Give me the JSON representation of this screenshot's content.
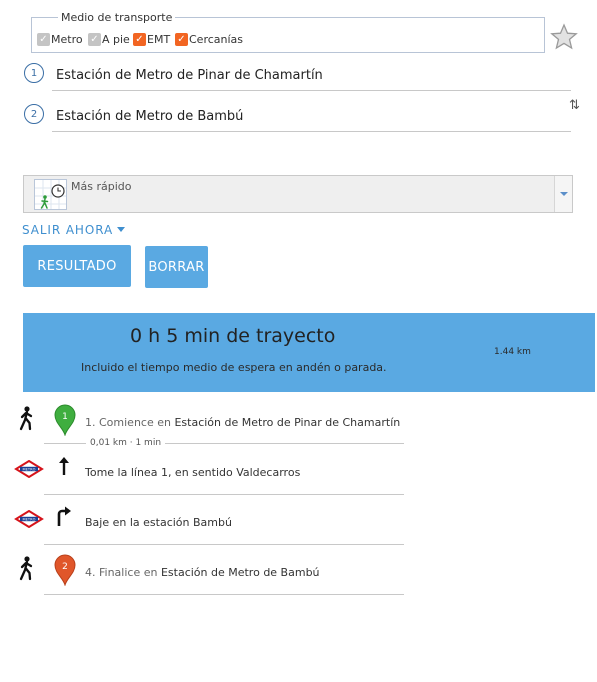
{
  "transport": {
    "legend": "Medio de transporte",
    "options": [
      {
        "label": "Metro",
        "checked": true,
        "disabled": true
      },
      {
        "label": "A pie",
        "checked": true,
        "disabled": true
      },
      {
        "label": "EMT",
        "checked": true,
        "disabled": false
      },
      {
        "label": "Cercanías",
        "checked": true,
        "disabled": false
      }
    ],
    "checkmark": "✓"
  },
  "stops": [
    {
      "number": "1",
      "value": "Estación de Metro de Pinar de Chamartín"
    },
    {
      "number": "2",
      "value": "Estación de Metro de Bambú"
    }
  ],
  "swap_glyph": "⇅",
  "route_type": {
    "selected": "Más rápido"
  },
  "depart": {
    "label": "SALIR AHORA"
  },
  "buttons": {
    "result": "RESULTADO",
    "clear": "BORRAR"
  },
  "summary": {
    "duration": "0 h 5 min de trayecto",
    "note": "Incluido el tiempo medio de espera en andén o parada.",
    "distance": "1.44 km"
  },
  "steps": [
    {
      "marker": "1",
      "prefix": "1. Comience en",
      "place": "Estación de Metro de Pinar de Chamartín"
    },
    {
      "text": "Tome la línea 1, en sentido Valdecarros"
    },
    {
      "text": "Baje en la estación Bambú"
    },
    {
      "marker": "2",
      "prefix": "4. Finalice en",
      "place": "Estación de Metro de Bambú"
    }
  ],
  "segment_info": "0,01 km · 1 min",
  "colors": {
    "accent": "#5aa9e2",
    "checkbox_on": "#f26522",
    "marker_start": "#3fae3f",
    "marker_end": "#e0562a",
    "metro_logo": "#d6141b"
  }
}
